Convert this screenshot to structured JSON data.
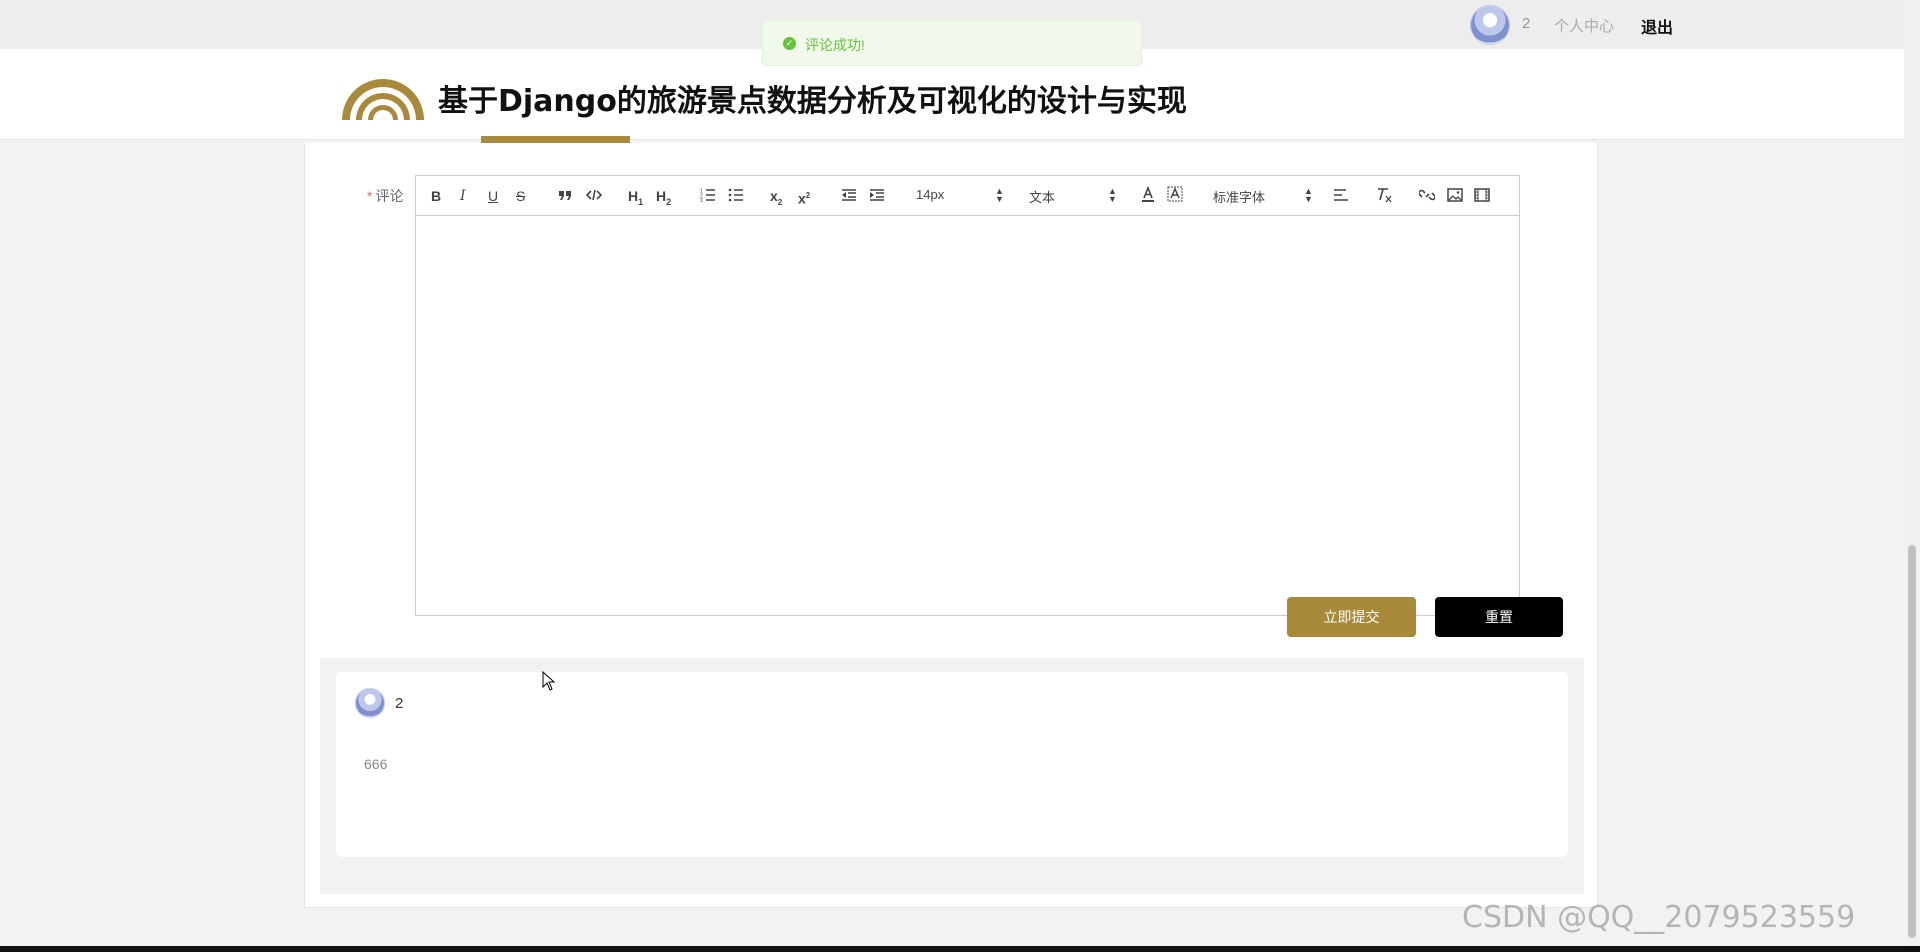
{
  "topbar": {
    "username": "2",
    "user_center": "个人中心",
    "logout": "退出"
  },
  "header": {
    "title": "基于Django的旅游景点数据分析及可视化的设计与实现"
  },
  "toast": {
    "message": "评论成功!"
  },
  "form": {
    "required_mark": "*",
    "label": "评论",
    "submit_label": "立即提交",
    "reset_label": "重置"
  },
  "toolbar": {
    "bold": "B",
    "italic": "I",
    "underline": "U",
    "strike": "S",
    "h1": "H1",
    "h2": "H2",
    "size": "14px",
    "header_select": "文本",
    "font_select": "标准字体"
  },
  "comments": [
    {
      "user": "2",
      "text": "666"
    }
  ],
  "watermark": "CSDN @QQ__2079523559",
  "colors": {
    "accent": "#a88a3a",
    "success": "#67c23a"
  }
}
